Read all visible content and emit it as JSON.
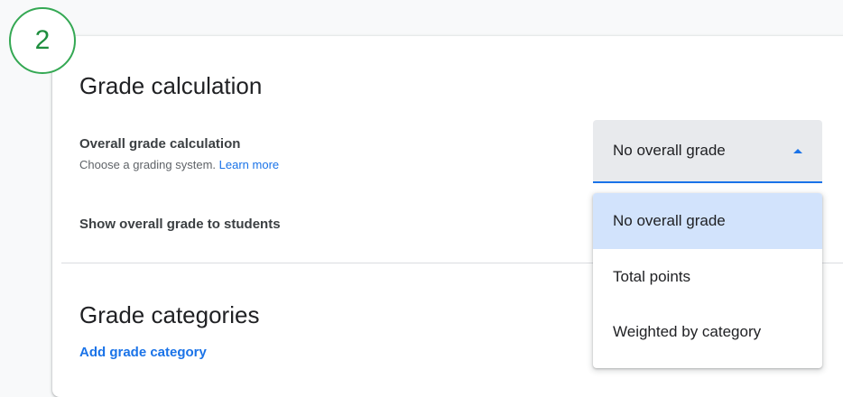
{
  "step_badge": "2",
  "grade_calculation": {
    "title": "Grade calculation",
    "overall_label": "Overall grade calculation",
    "overall_desc": "Choose a grading system.",
    "learn_more": "Learn more",
    "show_to_students_label": "Show overall grade to students"
  },
  "select": {
    "value": "No overall grade",
    "options": [
      "No overall grade",
      "Total points",
      "Weighted by category"
    ],
    "selected_index": 0
  },
  "grade_categories": {
    "title": "Grade categories",
    "add_link": "Add grade category"
  },
  "colors": {
    "accent": "#1a73e8",
    "badge": "#34a853",
    "selected_bg": "#d2e3fc"
  }
}
